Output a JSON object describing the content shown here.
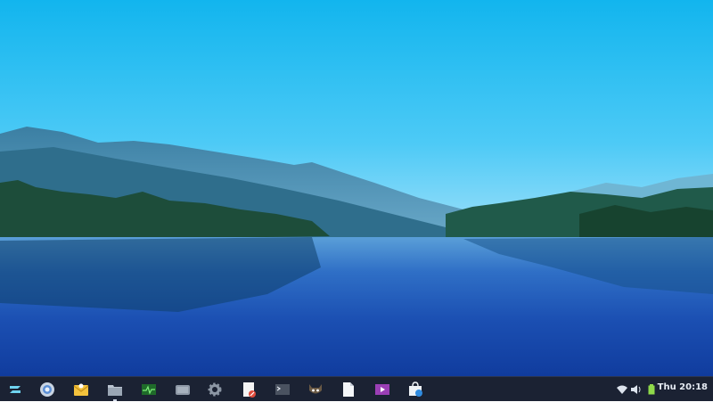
{
  "desktop": {
    "wallpaper": "lake-landscape"
  },
  "taskbar": {
    "menu_icon": "zorin-menu-icon",
    "apps": [
      {
        "name": "web-browser-icon",
        "running": false
      },
      {
        "name": "mail-icon",
        "running": false
      },
      {
        "name": "file-manager-icon",
        "running": true
      },
      {
        "name": "system-monitor-icon",
        "running": false
      },
      {
        "name": "screenshot-icon",
        "running": false
      },
      {
        "name": "settings-icon",
        "running": false
      },
      {
        "name": "text-editor-icon",
        "running": false
      },
      {
        "name": "terminal-icon",
        "running": false
      },
      {
        "name": "gimp-icon",
        "running": false
      },
      {
        "name": "document-icon",
        "running": false
      },
      {
        "name": "video-player-icon",
        "running": false
      },
      {
        "name": "software-store-icon",
        "running": false
      }
    ],
    "tray": {
      "wifi_icon": "wifi-icon",
      "volume_icon": "volume-icon",
      "battery_icon": "battery-icon",
      "clock": "Thu 20:18"
    }
  },
  "colors": {
    "taskbar_bg": "#1b2233",
    "sky": "#16b9ee",
    "water": "#1140a2"
  }
}
